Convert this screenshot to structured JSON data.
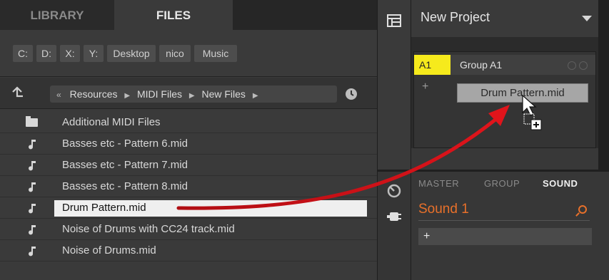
{
  "browser": {
    "tabs": [
      "LIBRARY",
      "FILES"
    ],
    "active_tab": "FILES",
    "drives": [
      "C:",
      "D:",
      "X:",
      "Y:",
      "Desktop",
      "nico",
      "Music"
    ],
    "path": {
      "back_glyph": "«",
      "crumbs": [
        "Resources",
        "MIDI Files",
        "New Files"
      ]
    },
    "files": [
      {
        "name": "Additional MIDI Files",
        "type": "folder"
      },
      {
        "name": "Basses etc - Pattern 6.mid",
        "type": "midi"
      },
      {
        "name": "Basses etc - Pattern 7.mid",
        "type": "midi"
      },
      {
        "name": "Basses etc - Pattern 8.mid",
        "type": "midi"
      },
      {
        "name": "Drum Pattern.mid",
        "type": "midi",
        "selected": true
      },
      {
        "name": "Noise of Drums with CC24 track.mid",
        "type": "midi"
      },
      {
        "name": "Noise of Drums.mid",
        "type": "midi"
      }
    ]
  },
  "arranger": {
    "project_title": "New Project",
    "group": {
      "badge": "A1",
      "name": "Group A1"
    },
    "plus_label": "+",
    "drag_ghost_label": "Drum Pattern.mid"
  },
  "sound_panel": {
    "tabs": [
      "MASTER",
      "GROUP",
      "SOUND"
    ],
    "active_tab": "SOUND",
    "sound_name": "Sound 1",
    "plus_label": "+"
  },
  "colors": {
    "accent_yellow": "#f6ea1c",
    "accent_orange": "#e8702a",
    "drag_arrow": "#e0141b"
  }
}
